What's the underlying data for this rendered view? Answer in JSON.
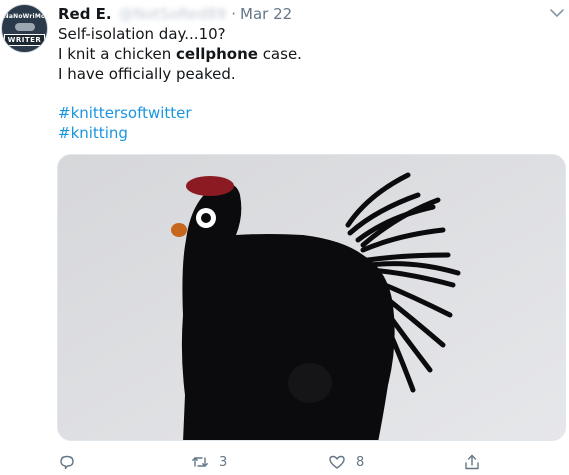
{
  "tweet": {
    "author": {
      "name": "Red E.",
      "handle": "@NotSoRed89",
      "avatar_text_top": "NaNoWriMo",
      "avatar_text_bottom": "WRITER"
    },
    "separator": "·",
    "date": "Mar 22",
    "lines": {
      "line1": "Self-isolation day...10?",
      "line2_before": "I knit a chicken ",
      "line2_bold": "cellphone",
      "line2_after": " case.",
      "line3": "I have officially peaked."
    },
    "hashtags": [
      "#knittersoftwitter",
      "#knitting"
    ],
    "media": {
      "description_icon": "knitted-chicken-photo"
    },
    "actions": {
      "reply": {
        "icon": "reply-icon",
        "count": ""
      },
      "retweet": {
        "icon": "retweet-icon",
        "count": "3"
      },
      "like": {
        "icon": "heart-icon",
        "count": "8"
      },
      "share": {
        "icon": "share-icon",
        "count": ""
      }
    },
    "colors": {
      "link": "#1b95e0",
      "secondary": "#657786",
      "text": "#14171a"
    }
  }
}
